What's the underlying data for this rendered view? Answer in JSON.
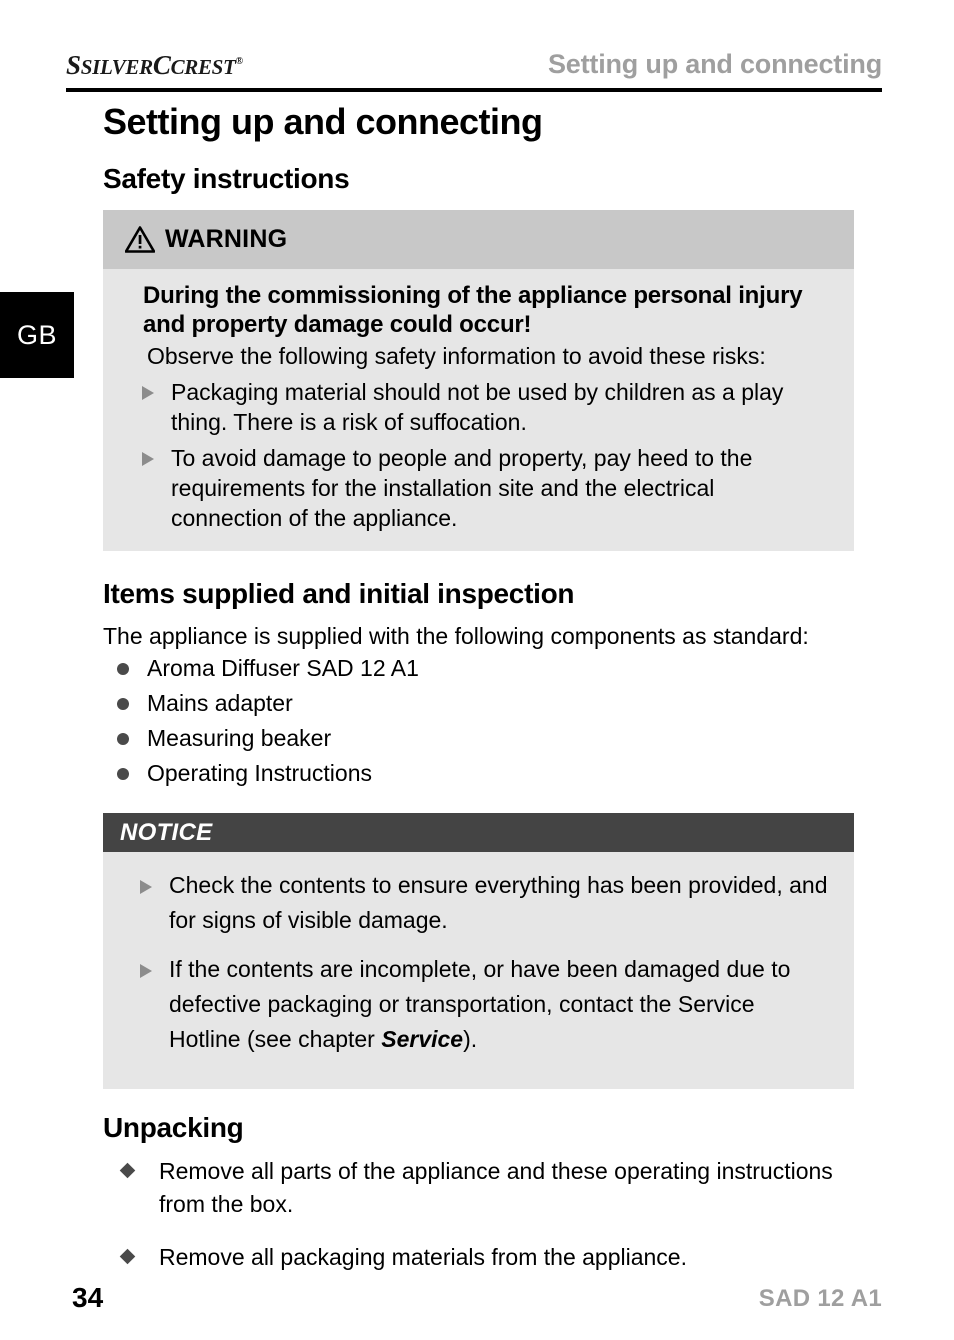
{
  "header": {
    "brand_silver": "SILVER",
    "brand_crest": "CREST",
    "brand_registered": "®",
    "chapter": "Setting up and connecting"
  },
  "language_tab": {
    "label": "GB"
  },
  "main": {
    "page_title": "Setting up and connecting",
    "safety": {
      "heading": "Safety instructions",
      "warning_label": "WARNING",
      "warning_icon": "warning-triangle-icon",
      "lead": "During the commissioning of the appliance personal injury and property damage could occur!",
      "sub": "Observe the following safety information to avoid these risks:",
      "bullets": [
        "Packaging material should not be used by children as a play thing. There is a risk of suffocation.",
        "To avoid damage to people and property, pay heed to the requirements for the installation site and the electrical connection of the appliance."
      ]
    },
    "items_supplied": {
      "heading": "Items supplied and initial inspection",
      "intro": "The appliance is supplied with the following components as standard:",
      "items": [
        "Aroma Diffuser SAD 12 A1",
        "Mains adapter",
        "Measuring beaker",
        "Operating Instructions"
      ]
    },
    "notice": {
      "label": "NOTICE",
      "bullets": [
        "Check the contents to ensure everything has been provided, and for signs of visible damage."
      ],
      "bullet_service_prefix": "If the contents are incomplete, or have been damaged due to defective packaging or transportation, contact the Service Hotline (see chapter ",
      "bullet_service_emphasis": "Service",
      "bullet_service_suffix": ")."
    },
    "unpacking": {
      "heading": "Unpacking",
      "steps": [
        "Remove all parts of the appliance and these operating instructions from the box.",
        "Remove all packaging materials from the appliance."
      ]
    }
  },
  "footer": {
    "page_number": "34",
    "model": "SAD 12 A1"
  },
  "colors": {
    "warning_head_bg": "#c8c8c8",
    "box_body_bg": "#e6e6e6",
    "notice_head_bg": "#444444",
    "header_grey_text": "#9f9f9f",
    "bullet_grey": "#8c8c8c"
  }
}
